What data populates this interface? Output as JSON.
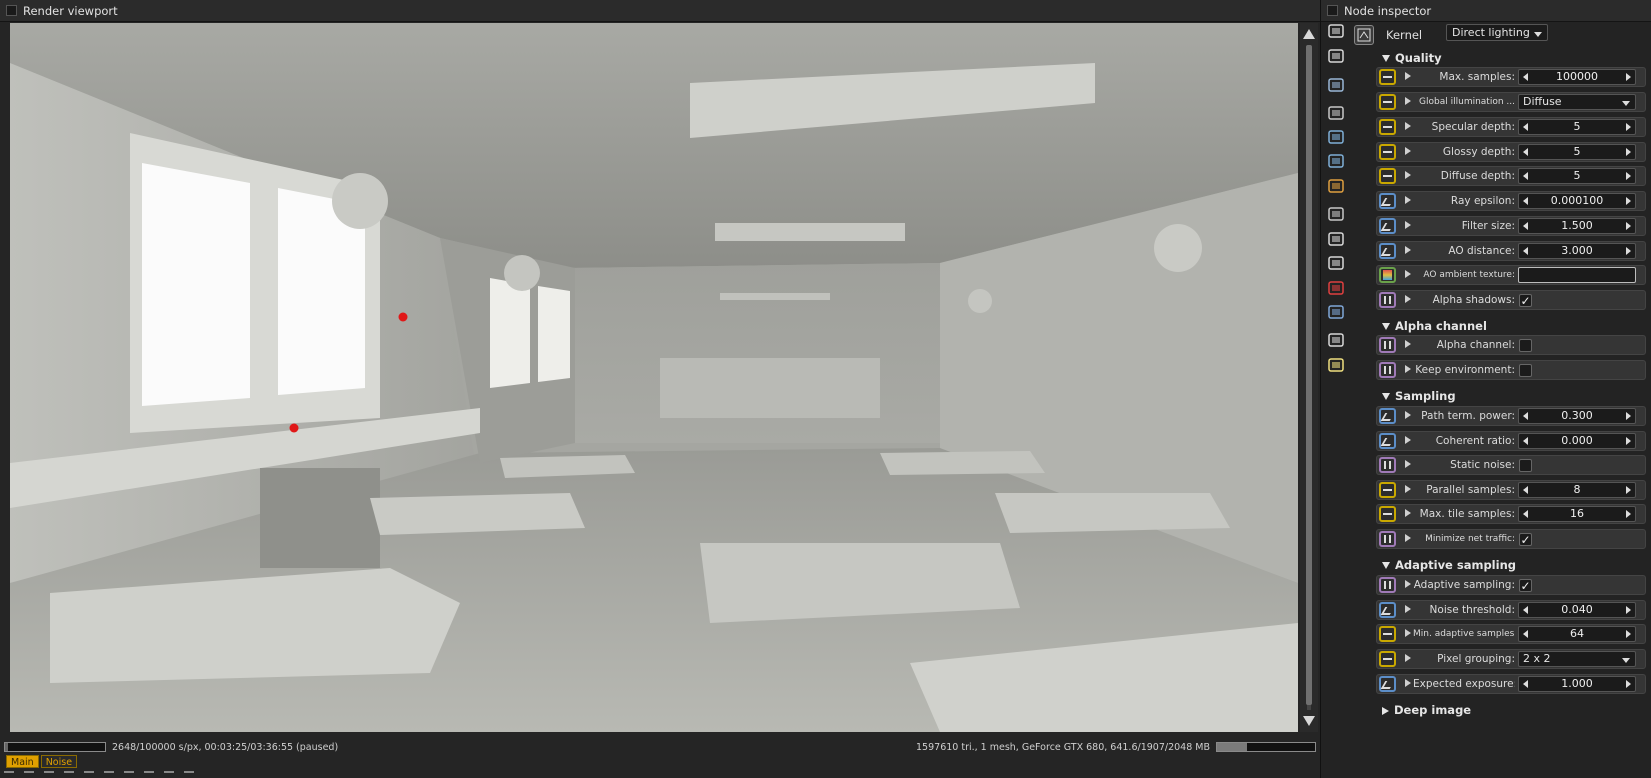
{
  "viewport": {
    "title": "Render viewport",
    "status_left": "2648/100000 s/px, 00:03:25/03:36:55 (paused)",
    "status_right": "1597610 tri., 1 mesh, GeForce GTX 680, 641.6/1907/2048 MB",
    "progress": 0.026,
    "memory_fraction": 0.31,
    "tabs": [
      {
        "label": "Main",
        "active": true
      },
      {
        "label": "Noise",
        "active": false
      }
    ]
  },
  "inspector": {
    "title": "Node inspector",
    "kernel_label": "Kernel",
    "kernel_value": "Direct lighting",
    "sections": [
      {
        "title": "Quality",
        "expanded": true
      },
      {
        "title": "Alpha channel",
        "expanded": true
      },
      {
        "title": "Sampling",
        "expanded": true
      },
      {
        "title": "Adaptive sampling",
        "expanded": true
      },
      {
        "title": "Deep image",
        "expanded": false
      }
    ],
    "params": [
      {
        "label": "Max. samples:",
        "value": "100000",
        "kind": "spin",
        "pin": "int"
      },
      {
        "label": "Global illumination ...",
        "value": "Diffuse",
        "kind": "select",
        "pin": "int"
      },
      {
        "label": "Specular depth:",
        "value": "5",
        "kind": "spin",
        "pin": "int"
      },
      {
        "label": "Glossy depth:",
        "value": "5",
        "kind": "spin",
        "pin": "int"
      },
      {
        "label": "Diffuse depth:",
        "value": "5",
        "kind": "spin",
        "pin": "int"
      },
      {
        "label": "Ray epsilon:",
        "value": "0.000100",
        "kind": "spin",
        "pin": "float"
      },
      {
        "label": "Filter size:",
        "value": "1.500",
        "kind": "spin",
        "pin": "float"
      },
      {
        "label": "AO distance:",
        "value": "3.000",
        "kind": "spin",
        "pin": "float"
      },
      {
        "label": "AO ambient texture:",
        "value": "",
        "kind": "texture",
        "pin": "texture"
      },
      {
        "label": "Alpha shadows:",
        "value": "✓",
        "kind": "check",
        "pin": "bool"
      },
      {
        "label": "Alpha channel:",
        "value": "",
        "kind": "check",
        "pin": "bool"
      },
      {
        "label": "Keep environment:",
        "value": "",
        "kind": "check",
        "pin": "bool"
      },
      {
        "label": "Path term. power:",
        "value": "0.300",
        "kind": "spin",
        "pin": "float"
      },
      {
        "label": "Coherent ratio:",
        "value": "0.000",
        "kind": "spin",
        "pin": "float"
      },
      {
        "label": "Static noise:",
        "value": "",
        "kind": "check",
        "pin": "bool"
      },
      {
        "label": "Parallel samples:",
        "value": "8",
        "kind": "spin",
        "pin": "int"
      },
      {
        "label": "Max. tile samples:",
        "value": "16",
        "kind": "spin",
        "pin": "int"
      },
      {
        "label": "Minimize net traffic:",
        "value": "✓",
        "kind": "check",
        "pin": "bool"
      },
      {
        "label": "Adaptive sampling:",
        "value": "✓",
        "kind": "check",
        "pin": "bool"
      },
      {
        "label": "Noise threshold:",
        "value": "0.040",
        "kind": "spin",
        "pin": "float"
      },
      {
        "label": "Min. adaptive samples:",
        "value": "64",
        "kind": "spin",
        "pin": "int"
      },
      {
        "label": "Pixel grouping:",
        "value": "2 x 2",
        "kind": "select",
        "pin": "int"
      },
      {
        "label": "Expected exposure:",
        "value": "1.000",
        "kind": "spin",
        "pin": "float"
      }
    ]
  },
  "colors": {
    "accent": "#e0a000",
    "pin_int": "#c9a800",
    "pin_float": "#5c8ec8",
    "pin_bool": "#a07ab8",
    "pin_texture": "#6aa24a"
  },
  "side_icons": [
    "render-target-icon",
    "layers-icon",
    "image-icon",
    "camera-icon",
    "database-icon",
    "database-icon",
    "materials-icon",
    "film-icon",
    "clock-icon",
    "kernel-icon",
    "cube-red-icon",
    "cube-blue-icon",
    "image-icon",
    "sun-icon"
  ]
}
